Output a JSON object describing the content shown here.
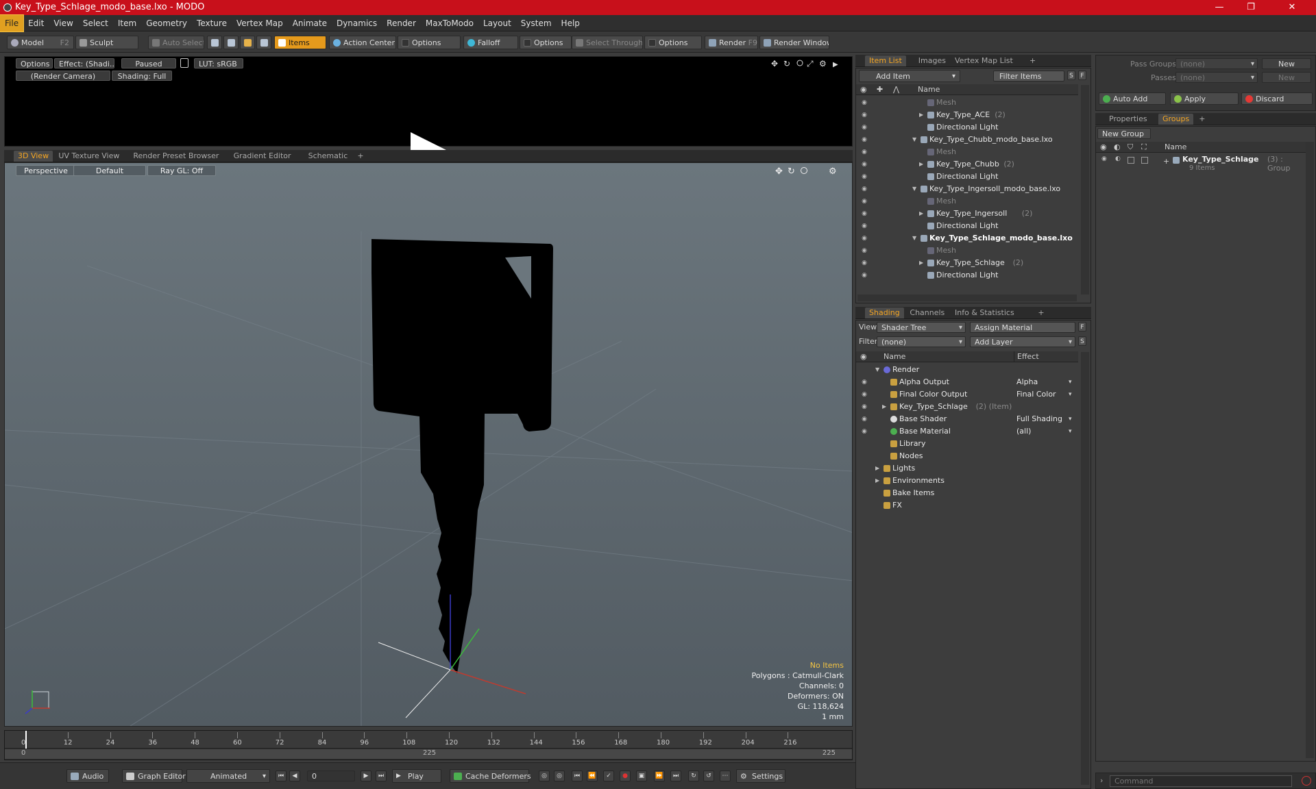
{
  "window": {
    "title": "Key_Type_Schlage_modo_base.lxo - MODO"
  },
  "menu": [
    "File",
    "Edit",
    "View",
    "Select",
    "Item",
    "Geometry",
    "Texture",
    "Vertex Map",
    "Animate",
    "Dynamics",
    "Render",
    "MaxToModo",
    "Layout",
    "System",
    "Help"
  ],
  "toolbar": {
    "model": "Model",
    "model_key": "F2",
    "sculpt": "Sculpt",
    "auto_select": "Auto Select",
    "items": "Items",
    "action_center": "Action Center",
    "options": "Options",
    "falloff": "Falloff",
    "select_through": "Select Through",
    "render": "Render",
    "render_key": "F9",
    "render_window": "Render Window"
  },
  "preview": {
    "options": "Options",
    "effect": "Effect: (Shadi...",
    "paused": "Paused",
    "lut": "LUT: sRGB",
    "camera": "(Render Camera)",
    "shading": "Shading: Full"
  },
  "viewport_tabs": [
    "3D View",
    "UV Texture View",
    "Render Preset Browser",
    "Gradient Editor",
    "Schematic",
    "+"
  ],
  "viewport": {
    "perspective": "Perspective",
    "default": "Default",
    "raygl": "Ray GL: Off",
    "stats": {
      "no_items": "No Items",
      "polygons": "Polygons : Catmull-Clark",
      "channels": "Channels: 0",
      "deformers": "Deformers: ON",
      "gl": "GL: 118,624",
      "unit": "1 mm"
    }
  },
  "timeline": {
    "ticks": [
      "0",
      "12",
      "24",
      "36",
      "48",
      "60",
      "72",
      "84",
      "96",
      "108",
      "120",
      "132",
      "144",
      "156",
      "168",
      "180",
      "192",
      "204",
      "216"
    ],
    "sub_left": "0",
    "sub_mid": "225",
    "sub_right": "225"
  },
  "bottombar": {
    "audio": "Audio",
    "graph_editor": "Graph Editor",
    "animated": "Animated",
    "frame": "0",
    "play": "Play",
    "cache_deformers": "Cache Deformers",
    "settings": "Settings"
  },
  "item_list": {
    "tabs": [
      "Item List",
      "Images",
      "Vertex Map List",
      "+"
    ],
    "add_item": "Add Item",
    "filter_items": "Filter Items",
    "s": "S",
    "f": "F",
    "col_name": "Name",
    "rows": [
      {
        "indent": 1,
        "label": "Mesh",
        "count": "",
        "dim": true,
        "arrow": "",
        "bold": false
      },
      {
        "indent": 1,
        "label": "Key_Type_ACE",
        "count": "(2)",
        "dim": false,
        "arrow": "▶",
        "bold": false
      },
      {
        "indent": 1,
        "label": "Directional Light",
        "count": "",
        "dim": false,
        "arrow": "",
        "bold": false
      },
      {
        "indent": 0,
        "label": "Key_Type_Chubb_modo_base.lxo",
        "count": "",
        "dim": false,
        "arrow": "▼",
        "bold": false
      },
      {
        "indent": 1,
        "label": "Mesh",
        "count": "",
        "dim": true,
        "arrow": "",
        "bold": false
      },
      {
        "indent": 1,
        "label": "Key_Type_Chubb",
        "count": "(2)",
        "dim": false,
        "arrow": "▶",
        "bold": false
      },
      {
        "indent": 1,
        "label": "Directional Light",
        "count": "",
        "dim": false,
        "arrow": "",
        "bold": false
      },
      {
        "indent": 0,
        "label": "Key_Type_Ingersoll_modo_base.lxo",
        "count": "",
        "dim": false,
        "arrow": "▼",
        "bold": false
      },
      {
        "indent": 1,
        "label": "Mesh",
        "count": "",
        "dim": true,
        "arrow": "",
        "bold": false
      },
      {
        "indent": 1,
        "label": "Key_Type_Ingersoll",
        "count": "(2)",
        "dim": false,
        "arrow": "▶",
        "bold": false
      },
      {
        "indent": 1,
        "label": "Directional Light",
        "count": "",
        "dim": false,
        "arrow": "",
        "bold": false
      },
      {
        "indent": 0,
        "label": "Key_Type_Schlage_modo_base.lxo",
        "count": "",
        "dim": false,
        "arrow": "▼",
        "bold": true
      },
      {
        "indent": 1,
        "label": "Mesh",
        "count": "",
        "dim": true,
        "arrow": "",
        "bold": false
      },
      {
        "indent": 1,
        "label": "Key_Type_Schlage",
        "count": "(2)",
        "dim": false,
        "arrow": "▶",
        "bold": false
      },
      {
        "indent": 1,
        "label": "Directional Light",
        "count": "",
        "dim": false,
        "arrow": "",
        "bold": false
      }
    ]
  },
  "shading": {
    "tabs": [
      "Shading",
      "Channels",
      "Info & Statistics",
      "+"
    ],
    "view_label": "View",
    "view_value": "Shader Tree",
    "assign_material": "Assign Material",
    "f": "F",
    "filter_label": "Filter",
    "filter_value": "(none)",
    "add_layer": "Add Layer",
    "s": "S",
    "col_name": "Name",
    "col_effect": "Effect",
    "rows": [
      {
        "indent": 0,
        "label": "Render",
        "count": "",
        "effect": "",
        "eye": false,
        "arrow": "▼"
      },
      {
        "indent": 1,
        "label": "Alpha Output",
        "count": "",
        "effect": "Alpha",
        "eye": true,
        "arrow": ""
      },
      {
        "indent": 1,
        "label": "Final Color Output",
        "count": "",
        "effect": "Final Color",
        "eye": true,
        "arrow": ""
      },
      {
        "indent": 1,
        "label": "Key_Type_Schlage",
        "count": "(2) (Item)",
        "effect": "",
        "eye": true,
        "arrow": "▶"
      },
      {
        "indent": 1,
        "label": "Base Shader",
        "count": "",
        "effect": "Full Shading",
        "eye": true,
        "arrow": ""
      },
      {
        "indent": 1,
        "label": "Base Material",
        "count": "",
        "effect": "(all)",
        "eye": true,
        "arrow": ""
      },
      {
        "indent": 1,
        "label": "Library",
        "count": "",
        "effect": "",
        "eye": false,
        "arrow": ""
      },
      {
        "indent": 1,
        "label": "Nodes",
        "count": "",
        "effect": "",
        "eye": false,
        "arrow": ""
      },
      {
        "indent": 0,
        "label": "Lights",
        "count": "",
        "effect": "",
        "eye": false,
        "arrow": "▶"
      },
      {
        "indent": 0,
        "label": "Environments",
        "count": "",
        "effect": "",
        "eye": false,
        "arrow": "▶"
      },
      {
        "indent": 0,
        "label": "Bake Items",
        "count": "",
        "effect": "",
        "eye": false,
        "arrow": ""
      },
      {
        "indent": 0,
        "label": "FX",
        "count": "",
        "effect": "",
        "eye": false,
        "arrow": ""
      }
    ]
  },
  "groups": {
    "pass_groups": "Pass Groups",
    "pass_groups_value": "(none)",
    "new": "New",
    "passes": "Passes",
    "passes_value": "(none)",
    "new2": "New",
    "auto_add": "Auto Add",
    "apply": "Apply",
    "discard": "Discard",
    "tabs": [
      "Properties",
      "Groups",
      "+"
    ],
    "new_group": "New Group",
    "col_name": "Name",
    "group_name": "Key_Type_Schlage",
    "group_count": "(3) : Group",
    "group_items": "9 Items",
    "command_placeholder": "Command"
  },
  "colors": {
    "accent": "#f5a623",
    "title_bar": "#c8101b"
  }
}
